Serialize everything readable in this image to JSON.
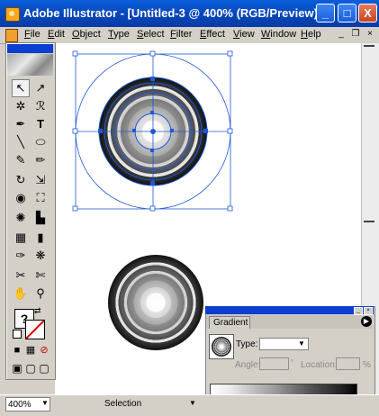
{
  "window": {
    "title": "Adobe Illustrator - [Untitled-3 @ 400% (RGB/Preview) ]",
    "minimize": "_",
    "maximize": "□",
    "close": "X"
  },
  "menu": {
    "items": [
      "File",
      "Edit",
      "Object",
      "Type",
      "Select",
      "Filter",
      "Effect",
      "View",
      "Window",
      "Help"
    ],
    "doc_minimize": "_",
    "doc_restore": "❐",
    "doc_close": "×"
  },
  "toolbox": {
    "tools": [
      {
        "name": "selection-tool",
        "glyph": "↖"
      },
      {
        "name": "direct-selection-tool",
        "glyph": "↗"
      },
      {
        "name": "magic-wand-tool",
        "glyph": "✲"
      },
      {
        "name": "lasso-tool",
        "glyph": "ℛ"
      },
      {
        "name": "pen-tool",
        "glyph": "✒"
      },
      {
        "name": "type-tool",
        "glyph": "T"
      },
      {
        "name": "line-segment-tool",
        "glyph": "╲"
      },
      {
        "name": "ellipse-tool",
        "glyph": "⬭"
      },
      {
        "name": "paintbrush-tool",
        "glyph": "✎"
      },
      {
        "name": "pencil-tool",
        "glyph": "✏"
      },
      {
        "name": "rotate-tool",
        "glyph": "↻"
      },
      {
        "name": "scale-tool",
        "glyph": "⇲"
      },
      {
        "name": "warp-tool",
        "glyph": "◉"
      },
      {
        "name": "free-transform-tool",
        "glyph": "⛶"
      },
      {
        "name": "symbol-sprayer-tool",
        "glyph": "✺"
      },
      {
        "name": "graph-tool",
        "glyph": "▙"
      },
      {
        "name": "mesh-tool",
        "glyph": "▦"
      },
      {
        "name": "gradient-tool",
        "glyph": "▮"
      },
      {
        "name": "eyedropper-tool",
        "glyph": "✑"
      },
      {
        "name": "blend-tool",
        "glyph": "❋"
      },
      {
        "name": "slice-tool",
        "glyph": "✂"
      },
      {
        "name": "scissors-tool",
        "glyph": "✄"
      },
      {
        "name": "hand-tool",
        "glyph": "✋"
      },
      {
        "name": "zoom-tool",
        "glyph": "⚲"
      }
    ],
    "fill_stroke": {
      "fill_glyph": "?",
      "swap_glyph": "⇄"
    },
    "color_modes": [
      "■",
      "▦",
      "⊘"
    ],
    "screen_modes": [
      "▣",
      "▢",
      "▢"
    ]
  },
  "statusbar": {
    "zoom": "400%",
    "zoom_arrow": "▼",
    "status": "Selection",
    "status_arrow": "▼"
  },
  "gradient_panel": {
    "tab": "Gradient",
    "menu_glyph": "▶",
    "type_label": "Type:",
    "type_value": "",
    "type_arrow": "▼",
    "angle_label": "Angle:",
    "location_label": "Location:",
    "location_unit": "%",
    "degree_symbol": "°",
    "minimize": "_",
    "close": "×"
  },
  "colors": {
    "titlebar": "#0846b8",
    "chrome": "#d4d0c8",
    "selection": "#1f57d6"
  }
}
